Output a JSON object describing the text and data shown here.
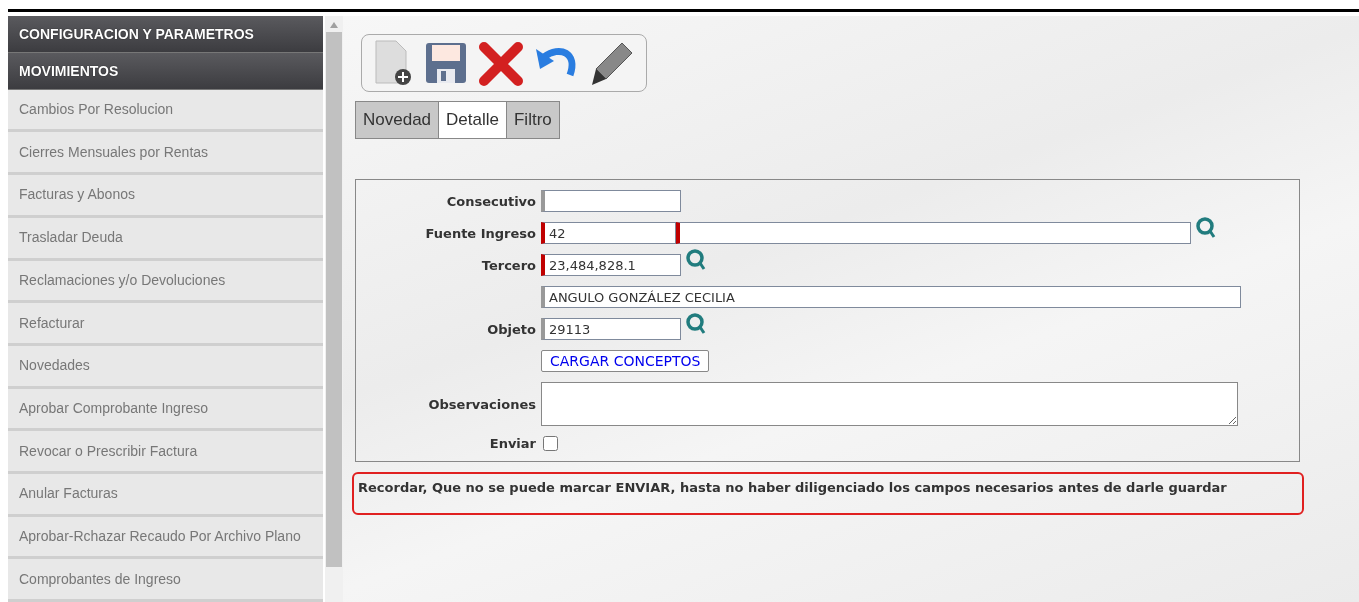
{
  "sidebar": {
    "sections": [
      {
        "title": "CONFIGURACION Y PARAMETROS"
      },
      {
        "title": "MOVIMIENTOS",
        "items": [
          "Cambios Por Resolucion",
          "Cierres Mensuales por Rentas",
          "Facturas y Abonos",
          "Trasladar Deuda",
          "Reclamaciones y/o Devoluciones",
          "Refacturar",
          "Novedades",
          "Aprobar Comprobante Ingreso",
          "Revocar o Prescribir Factura",
          "Anular Facturas",
          "Aprobar-Rchazar Recaudo Por Archivo Plano",
          "Comprobantes de Ingreso"
        ]
      }
    ]
  },
  "tabs": [
    {
      "label": "Novedad",
      "selected": false
    },
    {
      "label": "Detalle",
      "selected": true
    },
    {
      "label": "Filtro",
      "selected": false
    }
  ],
  "form": {
    "fields": [
      {
        "kind": "short",
        "label": "Consecutivo",
        "required": false,
        "search": false
      },
      {
        "kind": "pair",
        "label": "Fuente Ingreso",
        "value": "42",
        "required": true,
        "search": true
      },
      {
        "kind": "short",
        "label": "Tercero",
        "value": "23,484,828.1",
        "required": true,
        "search": true
      },
      {
        "kind": "long",
        "value": "ANGULO GONZÁLEZ CECILIA",
        "required": false,
        "search": false
      },
      {
        "kind": "short",
        "label": "Objeto",
        "value": "29113",
        "required": false,
        "search": true
      },
      {
        "kind": "button",
        "text": "CARGAR CONCEPTOS"
      },
      {
        "kind": "textarea",
        "label": "Observaciones"
      },
      {
        "kind": "checkbox",
        "label": "Enviar",
        "checked": false
      }
    ]
  },
  "note": "Recordar, Que no se puede marcar ENVIAR, hasta no haber diligenciado los campos necesarios antes de darle guardar"
}
